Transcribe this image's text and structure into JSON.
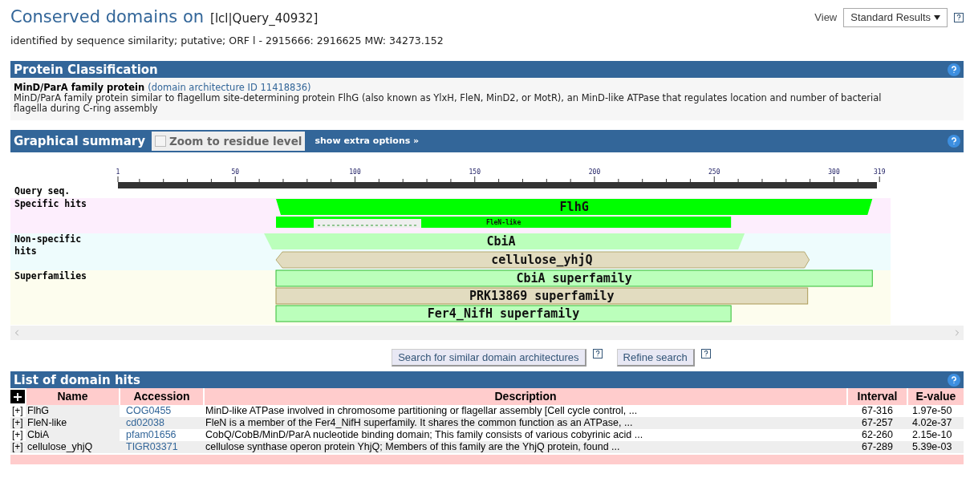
{
  "header": {
    "title": "Conserved domains on",
    "query": "[lcl|Query_40932]",
    "subtitle": "identified by sequence similarity; putative; ORF l - 2915666: 2916625 MW: 34273.152",
    "view_label": "View",
    "view_value": "Standard Results"
  },
  "classification": {
    "title": "Protein Classification",
    "name": "MinD/ParA family protein",
    "link": "(domain architecture ID 11418836)",
    "description": "MinD/ParA family protein similar to flagellum site-determining protein FlhG (also known as YlxH, FleN, MinD2, or MotR), an MinD-like ATPase that regulates location and number of bacterial flagella during C-ring assembly"
  },
  "graphical": {
    "title": "Graphical summary",
    "zoom_label": "Zoom to residue level",
    "zoom_checked": false,
    "extra_link": "show extra options »",
    "ticks": [
      "1",
      "50",
      "100",
      "150",
      "200",
      "250",
      "300",
      "319"
    ],
    "query_label": "Query seq.",
    "tracks": [
      {
        "kind": "specific",
        "label": "Specific hits",
        "color": "#fdeefd"
      },
      {
        "kind": "nonspecific",
        "label": "Non-specific hits",
        "color": "#eefcfd"
      },
      {
        "kind": "superfamily",
        "label": "Superfamilies",
        "color": "#fdfdee"
      }
    ],
    "hits": [
      {
        "name": "FlhG",
        "kind": "specific",
        "color": "#00ff00"
      },
      {
        "name": "FleN-like",
        "kind": "specific_small",
        "color": "#00ff00"
      },
      {
        "name": "CbiA",
        "kind": "nonspecific",
        "color": "#bbffbb"
      },
      {
        "name": "cellulose_yhjQ",
        "kind": "nonspecific",
        "color": "#e2dcc0"
      },
      {
        "name": "CbiA superfamily",
        "kind": "superfamily",
        "color": "#bbffbb"
      },
      {
        "name": "PRK13869 superfamily",
        "kind": "superfamily",
        "color": "#e2dcc0"
      },
      {
        "name": "Fer4_NifH superfamily",
        "kind": "superfamily",
        "color": "#bbffbb"
      }
    ]
  },
  "buttons": [
    "Search for similar domain architectures",
    "Refine search"
  ],
  "hits_list": {
    "title": "List of domain hits",
    "columns": [
      "Name",
      "Accession",
      "Description",
      "Interval",
      "E-value"
    ],
    "rows": [
      {
        "expander": "[+]",
        "name": "FlhG",
        "accession": "COG0455",
        "description": "MinD-like ATPase involved in chromosome partitioning or flagellar assembly [Cell cycle control, ...",
        "interval": "67-316",
        "evalue": "1.97e-50"
      },
      {
        "expander": "[+]",
        "name": "FleN-like",
        "accession": "cd02038",
        "description": "FleN is a member of the Fer4_NifH superfamily. It shares the common function as an ATPase, ...",
        "interval": "67-257",
        "evalue": "4.02e-37"
      },
      {
        "expander": "[+]",
        "name": "CbiA",
        "accession": "pfam01656",
        "description": "CobQ/CobB/MinD/ParA nucleotide binding domain; This family consists of various cobyrinic acid ...",
        "interval": "62-260",
        "evalue": "2.15e-10"
      },
      {
        "expander": "[+]",
        "name": "cellulose_yhjQ",
        "accession": "TIGR03371",
        "description": "cellulose synthase operon protein YhjQ; Members of this family are the YhjQ protein, found ...",
        "interval": "67-289",
        "evalue": "5.39e-03"
      }
    ]
  }
}
